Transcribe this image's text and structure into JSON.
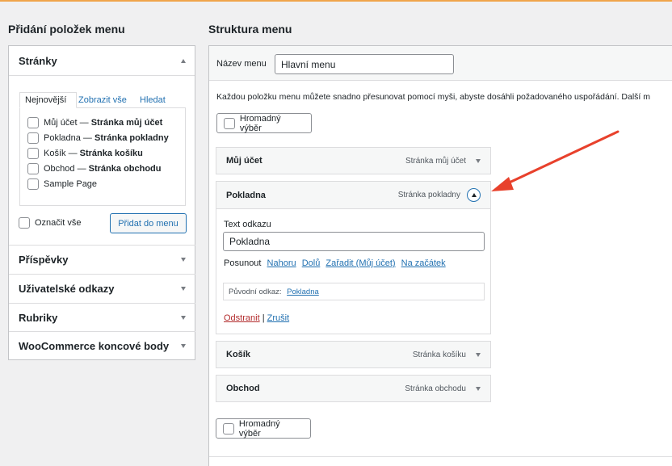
{
  "left": {
    "title": "Přidání položek menu",
    "pages": {
      "header": "Stránky",
      "tabs": [
        "Nejnovější",
        "Zobrazit vše",
        "Hledat"
      ],
      "items": [
        {
          "name": "Můj účet",
          "suffix": "Stránka můj účet"
        },
        {
          "name": "Pokladna",
          "suffix": "Stránka pokladny"
        },
        {
          "name": "Košík",
          "suffix": "Stránka košíku"
        },
        {
          "name": "Obchod",
          "suffix": "Stránka obchodu"
        },
        {
          "name": "Sample Page",
          "suffix": ""
        }
      ],
      "select_all": "Označit vše",
      "add_button": "Přidat do menu"
    },
    "sections": [
      "Příspěvky",
      "Uživatelské odkazy",
      "Rubriky",
      "WooCommerce koncové body"
    ]
  },
  "right": {
    "title": "Struktura menu",
    "name_label": "Název menu",
    "name_value": "Hlavní menu",
    "instructions": "Každou položku menu můžete snadno přesunovat pomocí myši, abyste dosáhli požadovaného uspořádání. Další m",
    "bulk_select": "Hromadný výběr",
    "items": [
      {
        "name": "Můj účet",
        "type": "Stránka můj účet"
      },
      {
        "name": "Pokladna",
        "type": "Stránka pokladny"
      },
      {
        "name": "Košík",
        "type": "Stránka košíku"
      },
      {
        "name": "Obchod",
        "type": "Stránka obchodu"
      }
    ],
    "edit": {
      "label": "Text odkazu",
      "value": "Pokladna",
      "move_label": "Posunout",
      "move_links": [
        "Nahoru",
        "Dolů",
        "Zařadit (Můj účet)",
        "Na začátek"
      ],
      "orig_label": "Původní odkaz:",
      "orig_link": "Pokladna",
      "remove": "Odstranit",
      "sep": "|",
      "cancel": "Zrušit"
    }
  },
  "colors": {
    "accent_link": "#2271b1",
    "arrow": "#e8412c",
    "remove": "#b32d2e",
    "top_bar": "#f0a44b"
  }
}
